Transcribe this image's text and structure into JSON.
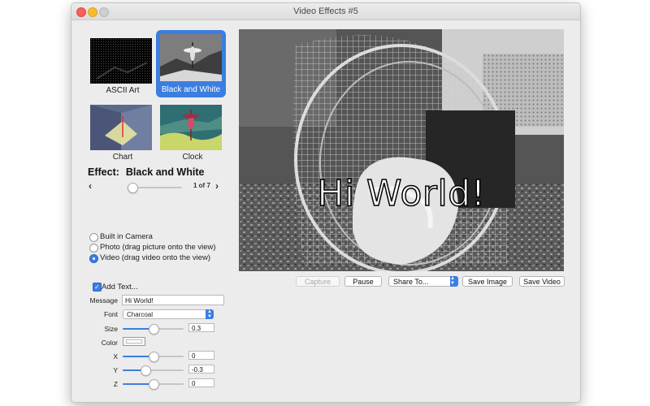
{
  "window": {
    "title": "Video Effects #5"
  },
  "effects": [
    {
      "label": "ASCII Art",
      "icon": "ascii-art-thumbnail",
      "selected": false
    },
    {
      "label": "Black and White",
      "icon": "black-and-white-thumbnail",
      "selected": true
    },
    {
      "label": "Chart",
      "icon": "chart-thumbnail",
      "selected": false
    },
    {
      "label": "Clock",
      "icon": "clock-thumbnail",
      "selected": false
    }
  ],
  "effect": {
    "label": "Effect:",
    "value": "Black and White",
    "page": "1 of 7",
    "prev": "‹",
    "next": "›",
    "position": 0.1
  },
  "source": {
    "options": [
      {
        "label": "Built in Camera",
        "selected": false
      },
      {
        "label": "Photo (drag picture onto the view)",
        "selected": false
      },
      {
        "label": "Video (drag video onto the view)",
        "selected": true
      }
    ]
  },
  "text_settings": {
    "add_text_label": "Add Text...",
    "add_text_checked": true,
    "message_label": "Message",
    "message_value": "Hi World!",
    "font_label": "Font",
    "font_value": "Charcoal",
    "size_label": "Size",
    "size_value": "0.3",
    "size_level": 0.5,
    "color_label": "Color",
    "x_label": "X",
    "x_value": "0",
    "x_level": 0.5,
    "y_label": "Y",
    "y_value": "-0.3",
    "y_level": 0.37,
    "z_label": "Z",
    "z_value": "0",
    "z_level": 0.5
  },
  "video": {
    "overlay_text": "Hi World!"
  },
  "buttons": {
    "capture": "Capture",
    "pause": "Pause",
    "share": "Share To...",
    "save_image": "Save Image",
    "save_video": "Save Video"
  },
  "colors": {
    "accent": "#3b7ee0",
    "close": "#fc5f57",
    "minimize": "#fdbc2e"
  }
}
